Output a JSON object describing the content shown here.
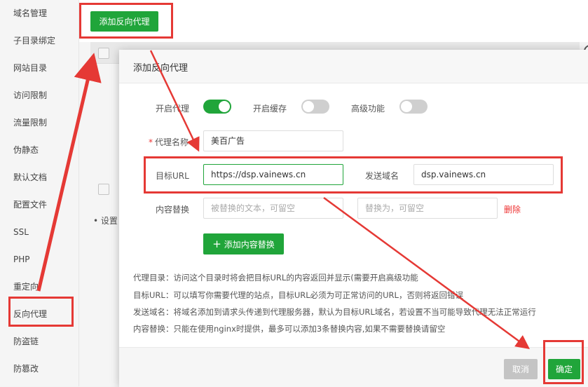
{
  "sidebar": {
    "items": [
      {
        "label": "域名管理"
      },
      {
        "label": "子目录绑定"
      },
      {
        "label": "网站目录"
      },
      {
        "label": "访问限制"
      },
      {
        "label": "流量限制"
      },
      {
        "label": "伪静态"
      },
      {
        "label": "默认文档"
      },
      {
        "label": "配置文件"
      },
      {
        "label": "SSL"
      },
      {
        "label": "PHP"
      },
      {
        "label": "重定向"
      },
      {
        "label": "反向代理"
      },
      {
        "label": "防盗链"
      },
      {
        "label": "防篡改"
      }
    ],
    "active": "反向代理"
  },
  "background": {
    "add_button": "添加反向代理",
    "note": "设置"
  },
  "dialog": {
    "title": "添加反向代理",
    "enable_proxy_label": "开启代理",
    "enable_proxy": true,
    "enable_cache_label": "开启缓存",
    "enable_cache": false,
    "advanced_label": "高级功能",
    "advanced": false,
    "proxy_name_label": "代理名称",
    "proxy_name_value": "美百广告",
    "target_url_label": "目标URL",
    "target_url_value": "https://dsp.vainews.cn",
    "send_domain_label": "发送域名",
    "send_domain_value": "dsp.vainews.cn",
    "content_replace_label": "内容替换",
    "replace_from_placeholder": "被替换的文本，可留空",
    "replace_to_placeholder": "替换为，可留空",
    "delete_label": "删除",
    "add_replace_button": "添加内容替换",
    "help": [
      "代理目录：访问这个目录时将会把目标URL的内容返回并显示(需要开启高级功能",
      "目标URL：可以填写你需要代理的站点，目标URL必须为可正常访问的URL，否则将返回错误",
      "发送域名：将域名添加到请求头传递到代理服务器，默认为目标URL域名，若设置不当可能导致代理无法正常运行",
      "内容替换：只能在使用nginx时提供，最多可以添加3条替换内容,如果不需要替换请留空"
    ],
    "cancel_button": "取消",
    "ok_button": "确定"
  },
  "colors": {
    "accent": "#20a53a",
    "annotation": "#e53935",
    "danger": "#e33333"
  }
}
